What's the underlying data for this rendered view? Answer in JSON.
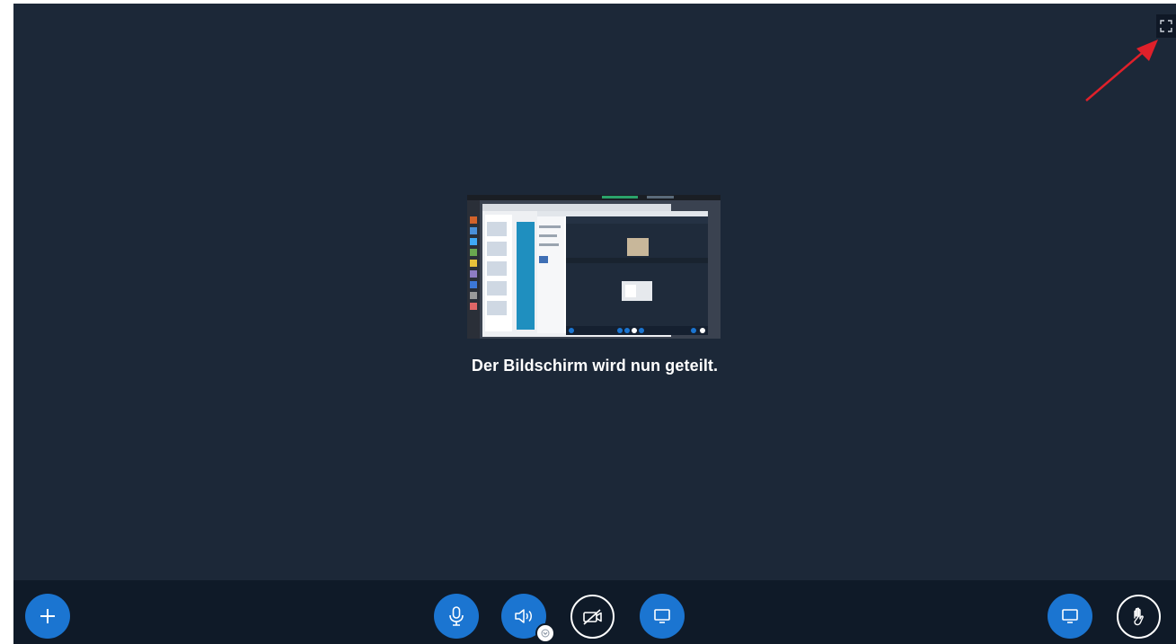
{
  "status": {
    "caption": "Der Bildschirm wird nun geteilt."
  },
  "icons": {
    "fullscreen": "fullscreen-icon",
    "plus": "plus-icon",
    "microphone": "microphone-icon",
    "speaker": "speaker-icon",
    "camera": "camera-off-icon",
    "screenshare": "screen-share-icon",
    "presentation": "presentation-icon",
    "hand": "raise-hand-icon",
    "dropdown": "chevron-down-icon"
  },
  "colors": {
    "stage_bg": "#1c2838",
    "actionbar_bg": "#0f1a28",
    "primary_blue": "#1b75d1",
    "annotation_red": "#e0202a"
  }
}
